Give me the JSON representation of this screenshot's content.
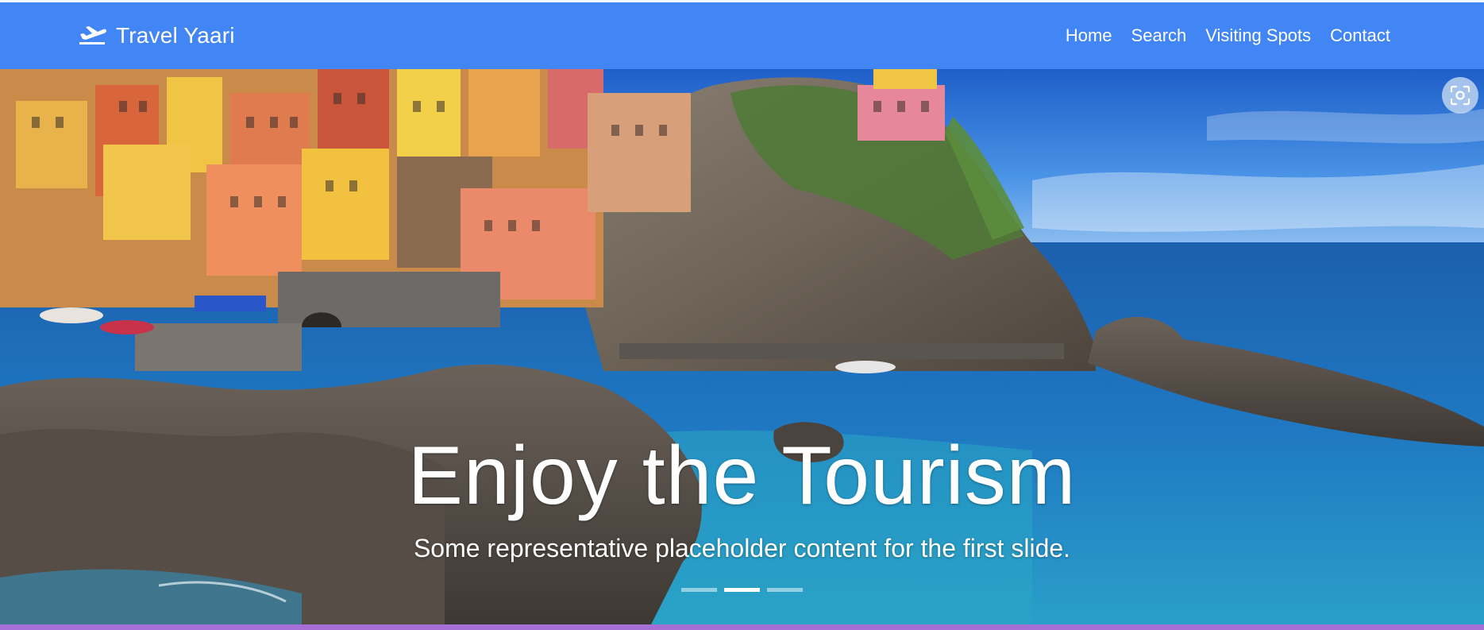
{
  "navbar": {
    "brand": "Travel Yaari",
    "brand_icon": "airplane-departure-icon",
    "links": [
      "Home",
      "Search",
      "Visiting Spots",
      "Contact"
    ]
  },
  "carousel": {
    "slides": [
      {
        "title": "Enjoy the Tourism",
        "text": "Some representative placeholder content for the first slide."
      }
    ],
    "indicator_count": 3,
    "active_index": 1
  },
  "overlay": {
    "lens_icon": "image-search-icon"
  },
  "colors": {
    "navbar": "#4285f4",
    "bottom_bar": "#a66fd6",
    "sea": "#1f74b8",
    "sky": "#2f7ee0"
  }
}
